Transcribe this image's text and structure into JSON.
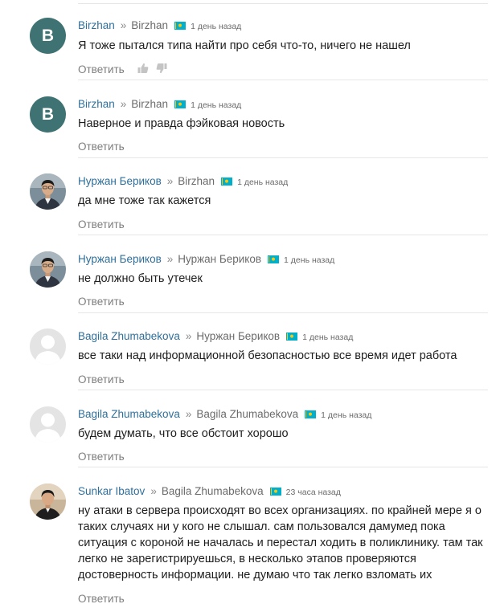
{
  "ui": {
    "reply_label": "Ответить",
    "reply_separator": "»"
  },
  "colors": {
    "author_link": "#2f6f9a",
    "avatar_letter_bg": "#3f7272",
    "divider": "#e6e6e6",
    "meta_gray": "#6b6b6b"
  },
  "comments": [
    {
      "author": "Birzhan",
      "reply_to": "Birzhan",
      "time": "1 день назад",
      "text": "Я тоже пытался типа найти про себя что-то, ничего не нашел",
      "avatar": {
        "type": "letter",
        "letter": "B"
      },
      "flag_icon": "kazakhstan-flag-icon",
      "shows_vote_icons": true
    },
    {
      "author": "Birzhan",
      "reply_to": "Birzhan",
      "time": "1 день назад",
      "text": "Наверное и правда фэйковая новость",
      "avatar": {
        "type": "letter",
        "letter": "B"
      },
      "flag_icon": "kazakhstan-flag-icon"
    },
    {
      "author": "Нуржан Бериков",
      "reply_to": "Birzhan",
      "time": "1 день назад",
      "text": "да мне тоже так кажется",
      "avatar": {
        "type": "photo",
        "icon": "user-photo-icon"
      },
      "flag_icon": "kazakhstan-flag-icon"
    },
    {
      "author": "Нуржан Бериков",
      "reply_to": "Нуржан Бериков",
      "time": "1 день назад",
      "text": "не должно быть утечек",
      "avatar": {
        "type": "photo",
        "icon": "user-photo-icon"
      },
      "flag_icon": "kazakhstan-flag-icon"
    },
    {
      "author": "Bagila Zhumabekova",
      "reply_to": "Нуржан Бериков",
      "time": "1 день назад",
      "text": "все таки над информационной безопасностью все время идет работа",
      "avatar": {
        "type": "placeholder",
        "icon": "default-avatar-icon"
      },
      "flag_icon": "kazakhstan-flag-icon"
    },
    {
      "author": "Bagila Zhumabekova",
      "reply_to": "Bagila Zhumabekova",
      "time": "1 день назад",
      "text": "будем думать, что все обстоит хорошо",
      "avatar": {
        "type": "placeholder",
        "icon": "default-avatar-icon"
      },
      "flag_icon": "kazakhstan-flag-icon"
    },
    {
      "author": "Sunkar Ibatov",
      "reply_to": "Bagila Zhumabekova",
      "time": "23 часа назад",
      "text": "ну атаки в сервера происходят во всех организациях. по крайней мере я о таких случаях ни у кого не слышал. сам пользовался дамумед пока ситуация с короной не началась и перестал ходить в поликлинику. там так легко не зарегистрируешься, в несколько этапов проверяются достоверность информации. не думаю что так легко взломать их",
      "avatar": {
        "type": "photo",
        "icon": "user-photo-icon"
      },
      "flag_icon": "kazakhstan-flag-icon"
    }
  ]
}
